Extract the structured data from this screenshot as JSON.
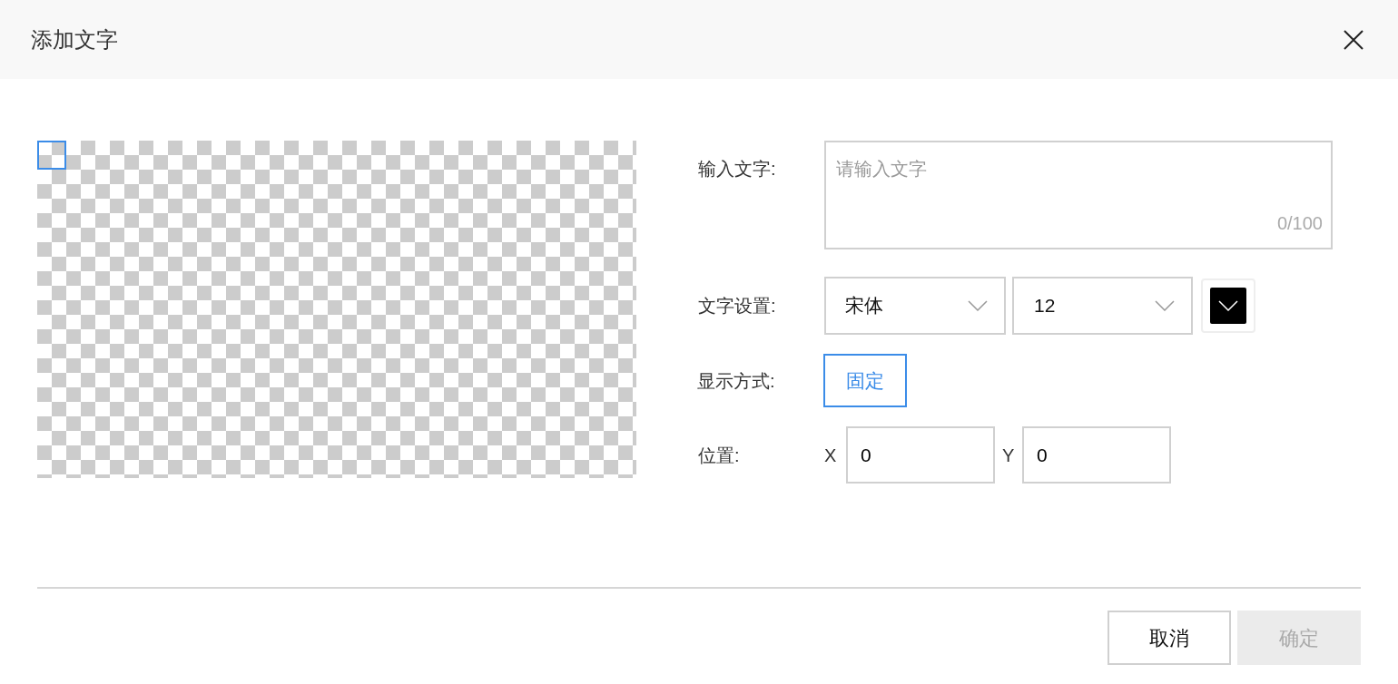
{
  "dialog": {
    "title": "添加文字"
  },
  "form": {
    "text_label": "输入文字:",
    "text_placeholder": "请输入文字",
    "counter": "0/100",
    "font_label": "文字设置:",
    "font_family": "宋体",
    "font_size": "12",
    "color_swatch": {
      "color": "#000000"
    },
    "display_label": "显示方式:",
    "display_modes": [
      {
        "label": "固定",
        "selected": true
      }
    ],
    "position_label": "位置:",
    "x_label": "X",
    "x_value": "0",
    "y_label": "Y",
    "y_value": "0"
  },
  "buttons": [
    {
      "label": "取消",
      "disabled": false
    },
    {
      "label": "确定",
      "disabled": true
    }
  ]
}
